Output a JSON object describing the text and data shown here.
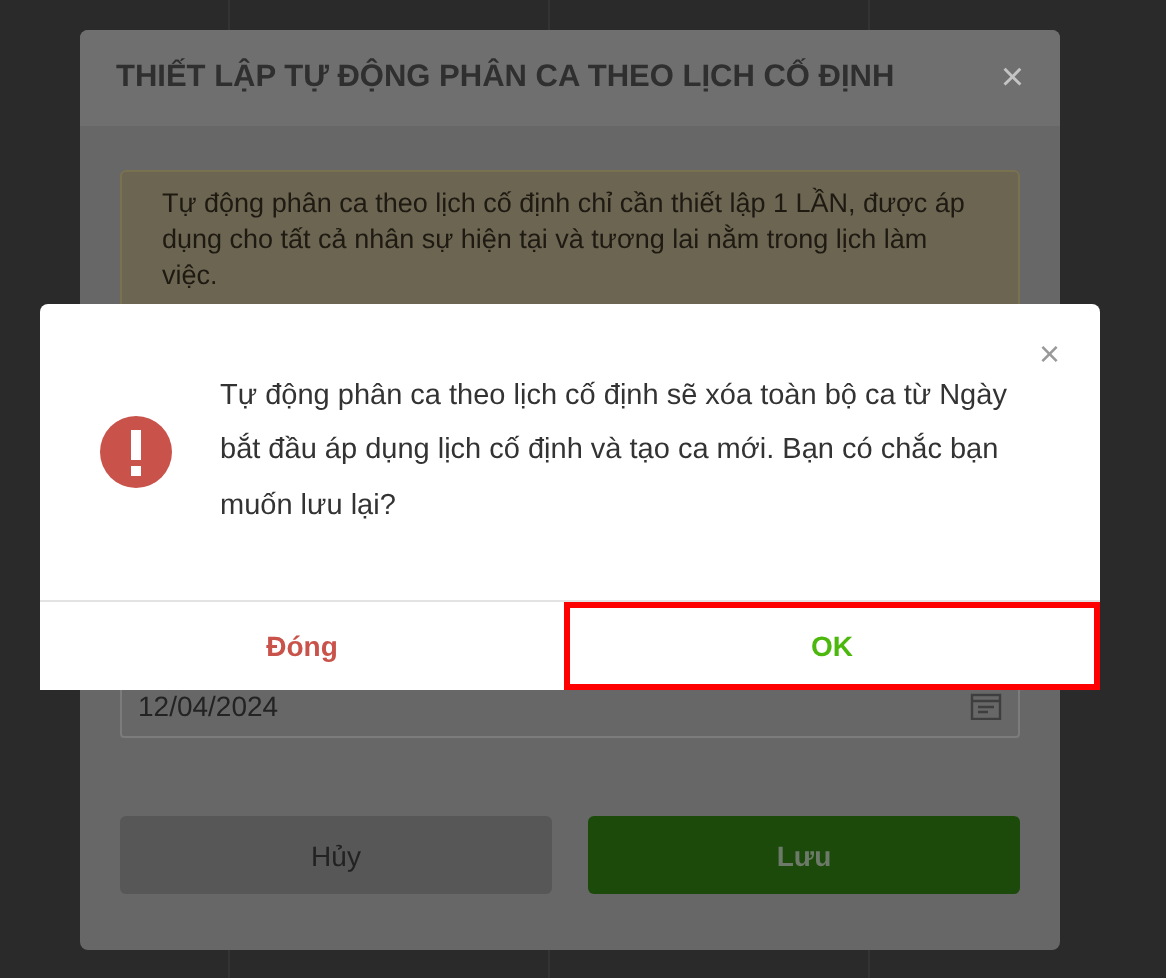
{
  "background_dialog": {
    "title": "THIẾT LẬP TỰ ĐỘNG PHÂN CA THEO LỊCH CỐ ĐỊNH",
    "close": "×",
    "notice": "Tự động phân ca theo lịch cố định chỉ cần thiết lập 1 LẦN, được áp dụng cho tất cả nhân sự hiện tại và tương lai nằm trong lịch làm việc.",
    "date_field": {
      "value": "12/04/2024"
    },
    "buttons": [
      {
        "label": "Hủy",
        "kind": "cancel"
      },
      {
        "label": "Lưu",
        "kind": "primary"
      }
    ]
  },
  "alert": {
    "close": "×",
    "message": "Tự động phân ca theo lịch cố định sẽ xóa toàn bộ ca từ Ngày bắt đầu áp dụng lịch cố định và tạo ca mới. Bạn có chắc bạn muốn lưu lại?",
    "buttons": [
      {
        "label": "Đóng",
        "kind": "dismiss",
        "highlighted": false
      },
      {
        "label": "OK",
        "kind": "confirm",
        "highlighted": true
      }
    ]
  }
}
